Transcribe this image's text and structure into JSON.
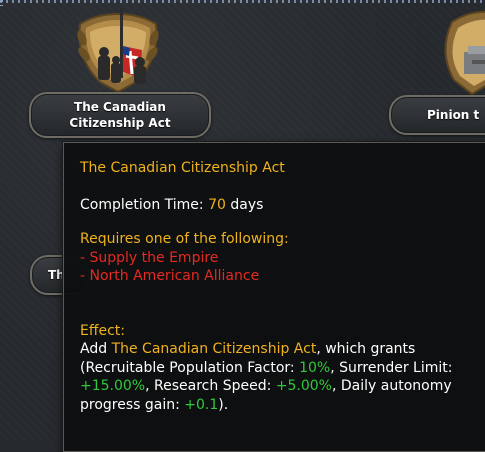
{
  "nodes": [
    {
      "title_line1": "The Canadian",
      "title_line2": "Citizenship Act"
    },
    {
      "title": "Pinion t"
    },
    {
      "title": "Th"
    }
  ],
  "tooltip": {
    "title": "The Canadian Citizenship Act",
    "completion_label": "Completion Time: ",
    "completion_value": "70",
    "completion_unit": " days",
    "requires_heading": "Requires one of the following:",
    "requirements": [
      "- Supply the Empire",
      "- North American Alliance"
    ],
    "effect_heading": "Effect:",
    "effect_add": "Add ",
    "effect_name": "The Canadian Citizenship Act",
    "effect_grants": ", which grants",
    "effect_open": "(",
    "mods": [
      {
        "label": "Recruitable Population Factor: ",
        "value": "10%"
      },
      {
        "label": "Surrender Limit: ",
        "value": "+15.00%"
      },
      {
        "label": "Research Speed: ",
        "value": "+5.00%"
      },
      {
        "label": "Daily autonomy progress gain: ",
        "value": "+0.1"
      }
    ],
    "sep": ", ",
    "effect_close": ")."
  },
  "colors": {
    "title": "#f0b21d",
    "requirement": "#e42a22",
    "bonus": "#2fc93a",
    "text": "#ffffff"
  }
}
